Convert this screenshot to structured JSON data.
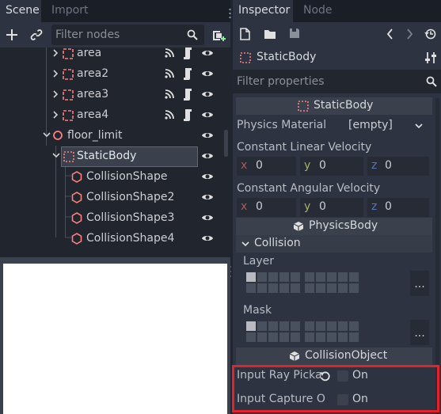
{
  "scene_dock": {
    "tabs": [
      {
        "label": "Scene",
        "active": true
      },
      {
        "label": "Import",
        "active": false
      }
    ],
    "filter_placeholder": "Filter nodes",
    "tree": [
      {
        "name": "area",
        "icon": "area-icon",
        "signals": true,
        "script": true
      },
      {
        "name": "area2",
        "icon": "area-icon",
        "signals": true,
        "script": true
      },
      {
        "name": "area3",
        "icon": "area-icon",
        "signals": true,
        "script": true
      },
      {
        "name": "area4",
        "icon": "area-icon",
        "signals": true,
        "script": true
      },
      {
        "name": "floor_limit",
        "icon": "spatial-icon"
      },
      {
        "name": "StaticBody",
        "icon": "static-body-icon",
        "selected": true
      },
      {
        "name": "CollisionShape",
        "icon": "collision-shape-icon"
      },
      {
        "name": "CollisionShape2",
        "icon": "collision-shape-icon"
      },
      {
        "name": "CollisionShape3",
        "icon": "collision-shape-icon"
      },
      {
        "name": "CollisionShape4",
        "icon": "collision-shape-icon"
      }
    ]
  },
  "inspector": {
    "tabs": [
      {
        "label": "Inspector",
        "active": true
      },
      {
        "label": "Node",
        "active": false
      }
    ],
    "object_name": "StaticBody",
    "filter_placeholder": "Filter properties",
    "sections": {
      "static_body": "StaticBody",
      "physics_body": "PhysicsBody",
      "collision_object": "CollisionObject"
    },
    "props": {
      "physics_material_label": "Physics Material",
      "physics_material_value": "[empty]",
      "linear_velocity_label": "Constant Linear Velocity",
      "angular_velocity_label": "Constant Angular Velocity",
      "axis_x": "x",
      "axis_y": "y",
      "axis_z": "z",
      "lin_x": "0",
      "lin_y": "0",
      "lin_z": "0",
      "ang_x": "0",
      "ang_y": "0",
      "ang_z": "0",
      "collision_group": "Collision",
      "layer_label": "Layer",
      "mask_label": "Mask",
      "more": "...",
      "input_ray_pickable_label": "Input Ray Picka",
      "input_ray_pickable_value": "On",
      "input_capture_label": "Input Capture O",
      "input_capture_value": "On"
    }
  },
  "colors": {
    "accent_red": "#e3222a",
    "node_pink": "#fc7f7f",
    "panel": "#2d3340",
    "background": "#202531"
  }
}
